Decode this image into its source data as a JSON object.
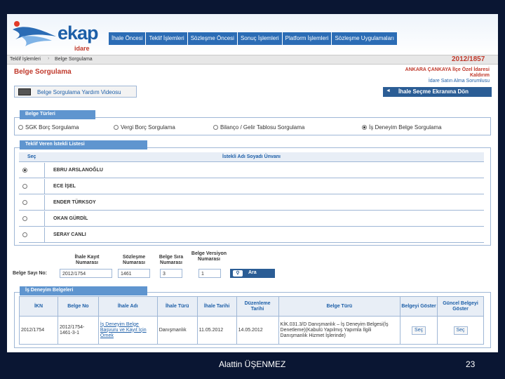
{
  "header": {
    "logo_text": "ekap",
    "logo_sub": "idare",
    "nav": [
      "İhale Öncesi",
      "Teklif İşlemleri",
      "Sözleşme Öncesi",
      "Sonuç İşlemleri",
      "Platform İşlemleri",
      "Sözleşme Uygulamaları"
    ]
  },
  "breadcrumb": {
    "items": [
      "Teklif İşlemleri",
      "Belge Sorgulama"
    ],
    "separator": "›",
    "reference": "2012/1857"
  },
  "page": {
    "title": "Belge Sorgulama",
    "office_name": "ANKARA ÇANKAYA İlçe Özel İdaresi Kaldırım",
    "office_unit": "İdare Satın Alma Sorumlusu",
    "help_button": "Belge Sorgulama Yardım Videosu",
    "back_button": "İhale Seçme Ekranına Dön",
    "back_arrow": "◄"
  },
  "document_types": {
    "legend": "Belge Türleri",
    "options": [
      {
        "label": "SGK Borç Sorgulama",
        "selected": false
      },
      {
        "label": "Vergi Borç Sorgulama",
        "selected": false
      },
      {
        "label": "Bilanço / Gelir Tablosu Sorgulama",
        "selected": false
      },
      {
        "label": "İş Deneyim Belge Sorgulama",
        "selected": true
      }
    ]
  },
  "bidders": {
    "legend": "Teklif Veren İstekli Listesi",
    "col_select": "Seç",
    "col_name": "İstekli Adı Soyadı Ünvanı",
    "rows": [
      {
        "name": "EBRU ARSLANOĞLU",
        "selected": true
      },
      {
        "name": "ECE İŞEL",
        "selected": false
      },
      {
        "name": "ENDER TÜRKSOY",
        "selected": false
      },
      {
        "name": "OKAN GÜRDİL",
        "selected": false
      },
      {
        "name": "SERAY CANLI",
        "selected": false
      }
    ]
  },
  "query": {
    "belge_sayi_label": "Belge Sayı No:",
    "belge_sayi_value": "2012/1754",
    "ihale_kayit_label": "İhale Kayıt Numarası",
    "sozlesme_label": "Sözleşme Numarası",
    "sozlesme_value": "1461",
    "belge_sira_label": "Belge Sıra Numarası",
    "belge_sira_value": "3",
    "versiyon_label": "Belge Versiyon Numarası",
    "versiyon_value": "1",
    "search_button": "Ara",
    "search_icon": "magnifier-icon"
  },
  "experience_docs": {
    "legend": "İş Deneyim Belgeleri",
    "columns": [
      "İKN",
      "Belge No",
      "İhale Adı",
      "İhale Türü",
      "İhale Tarihi",
      "Düzenleme Tarihi",
      "Belge Türü",
      "Belgeyi Göster",
      "Güncel Belgeyi Göster"
    ],
    "rows": [
      {
        "ikn": "2012/1754",
        "belge_no": "2012/1754-1461-3-1",
        "ihale_adi": "İş Deneyim Belge Başvuru ve Kayıt İçin Örnek",
        "ihale_turu": "Danışmanlık",
        "ihale_tarihi": "11.05.2012",
        "duzenleme_tarihi": "14.05.2012",
        "belge_turu": "KİK.031.3/D Danışmanlık – İş Deneyim Belgesi(İş Denetleme)(Kabulü Yapılmış Yapımla İlgili Danışmanlık Hizmet İşlerinde)",
        "goster": "Seç",
        "guncel_goster": "Seç"
      }
    ]
  },
  "slide": {
    "author": "Alattin ÜŞENMEZ",
    "page_number": "23"
  }
}
